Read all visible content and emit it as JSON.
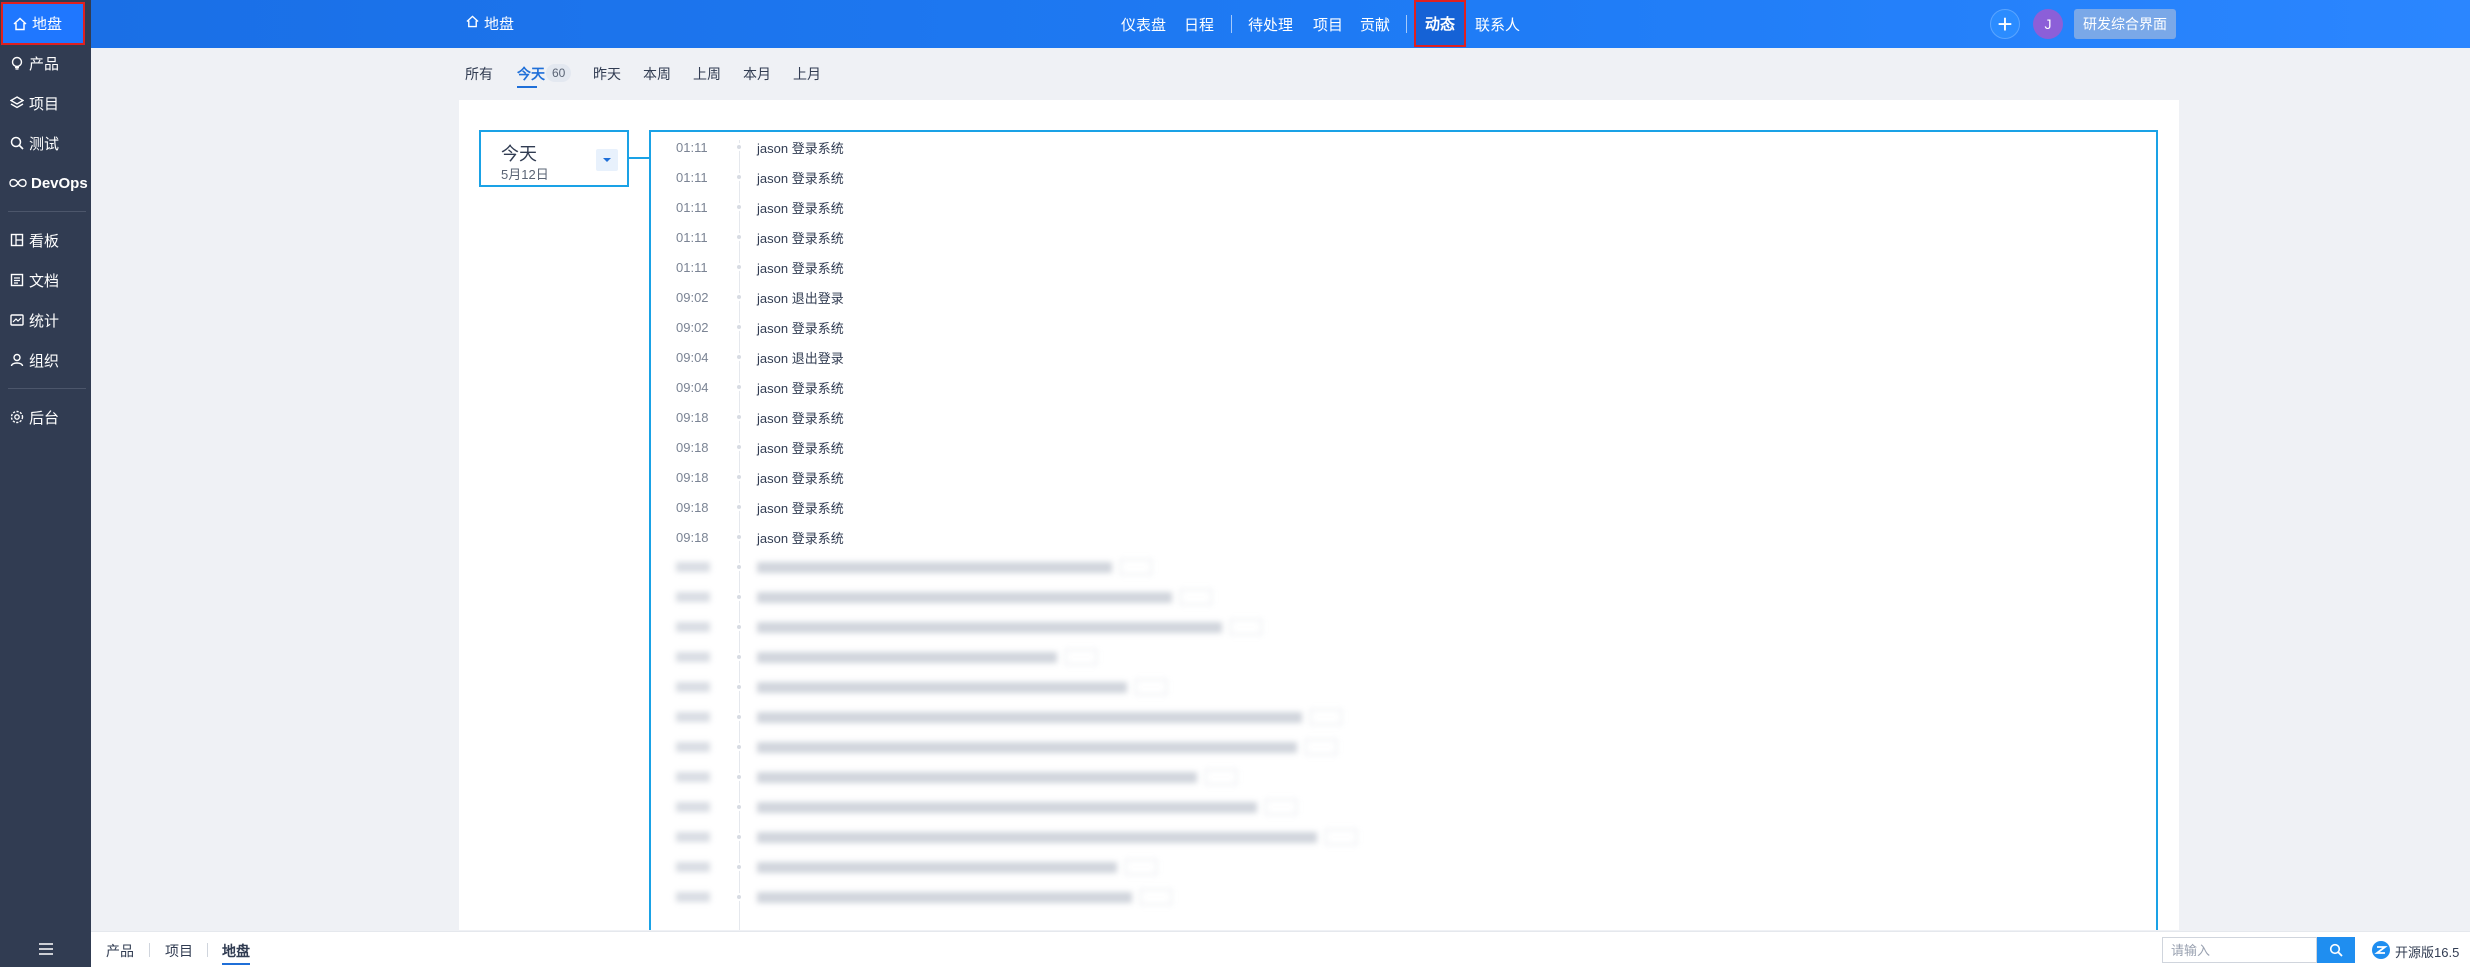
{
  "sidebar": {
    "items": [
      {
        "label": "地盘",
        "icon": "home-icon"
      },
      {
        "label": "产品",
        "icon": "lightbulb-icon"
      },
      {
        "label": "项目",
        "icon": "stack-icon"
      },
      {
        "label": "测试",
        "icon": "search-icon"
      },
      {
        "label": "DevOps",
        "icon": "infinity-icon"
      },
      {
        "label": "看板",
        "icon": "board-icon"
      },
      {
        "label": "文档",
        "icon": "document-icon"
      },
      {
        "label": "统计",
        "icon": "chart-icon"
      },
      {
        "label": "组织",
        "icon": "user-icon"
      },
      {
        "label": "后台",
        "icon": "gear-icon"
      }
    ],
    "menu_icon": "menu-icon"
  },
  "header": {
    "home_label": "地盘",
    "nav": [
      "仪表盘",
      "日程",
      "待处理",
      "项目",
      "贡献",
      "动态",
      "联系人"
    ],
    "active_nav": "动态",
    "avatar_letter": "J",
    "ui_switch_label": "研发综合界面",
    "accent_color": "#1f77ff"
  },
  "subnav": {
    "items": [
      "所有",
      "今天",
      "昨天",
      "本周",
      "上周",
      "本月",
      "上月"
    ],
    "active": "今天",
    "today_count": "60"
  },
  "timeline": {
    "date_day": "今天",
    "date_sub": "5月12日",
    "entries": [
      {
        "time": "01:11",
        "text": "jason 登录系统"
      },
      {
        "time": "01:11",
        "text": "jason 登录系统"
      },
      {
        "time": "01:11",
        "text": "jason 登录系统"
      },
      {
        "time": "01:11",
        "text": "jason 登录系统"
      },
      {
        "time": "01:11",
        "text": "jason 登录系统"
      },
      {
        "time": "09:02",
        "text": "jason 退出登录"
      },
      {
        "time": "09:02",
        "text": "jason 登录系统"
      },
      {
        "time": "09:04",
        "text": "jason 退出登录"
      },
      {
        "time": "09:04",
        "text": "jason 登录系统"
      },
      {
        "time": "09:18",
        "text": "jason 登录系统"
      },
      {
        "time": "09:18",
        "text": "jason 登录系统"
      },
      {
        "time": "09:18",
        "text": "jason 登录系统"
      },
      {
        "time": "09:18",
        "text": "jason 登录系统"
      },
      {
        "time": "09:18",
        "text": "jason 登录系统"
      }
    ],
    "blurred_count": 12
  },
  "footer": {
    "breadcrumbs": [
      "产品",
      "项目",
      "地盘"
    ],
    "active_breadcrumb": "地盘",
    "search_placeholder": "请输入",
    "version": "开源版16.5"
  }
}
